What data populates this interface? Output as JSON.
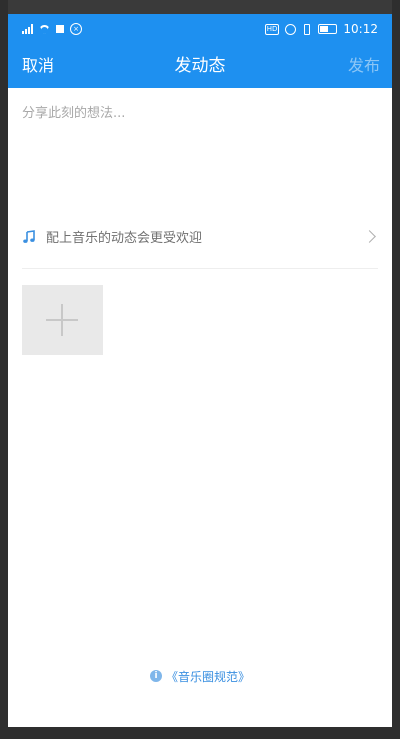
{
  "status_bar": {
    "time": "10:12",
    "battery_level": 0.6,
    "left_icons": [
      "signal-icon",
      "wifi-icon",
      "notification-square-icon",
      "blocked-circle-icon"
    ],
    "right_icons": [
      "hd-icon",
      "alarm-icon",
      "vibrate-icon",
      "battery-icon"
    ]
  },
  "nav": {
    "cancel_label": "取消",
    "title": "发动态",
    "publish_label": "发布"
  },
  "composer": {
    "placeholder": "分享此刻的想法..."
  },
  "music": {
    "icon": "music-note-icon",
    "label": "配上音乐的动态会更受欢迎"
  },
  "footer": {
    "rules_label": "《音乐圈规范》",
    "info_icon_glyph": "i"
  },
  "colors": {
    "primary": "#1e90f0",
    "publish_disabled": "#8cc6f6",
    "link": "#3a8fe0"
  }
}
